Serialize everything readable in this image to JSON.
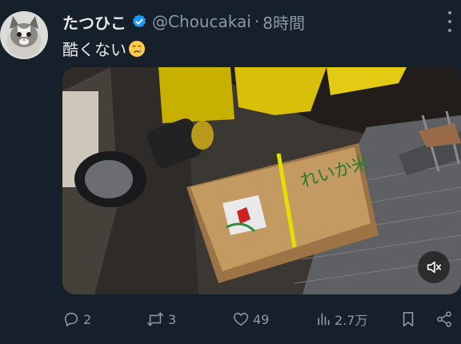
{
  "post": {
    "display_name": "たつひこ",
    "handle": "@Choucakai",
    "separator": "·",
    "time": "8時間",
    "text": "酷くない",
    "emoji_icon": "face-holding-back-tears-emoji"
  },
  "media": {
    "bag_text": "れいか米",
    "mute_icon": "speaker-muted-icon"
  },
  "actions": {
    "reply_count": "2",
    "repost_count": "3",
    "like_count": "49",
    "views_count": "2.7万"
  },
  "colors": {
    "background": "#15202b",
    "text": "#e7e9ea",
    "muted": "#8b98a5",
    "verified": "#1d9bf0"
  }
}
